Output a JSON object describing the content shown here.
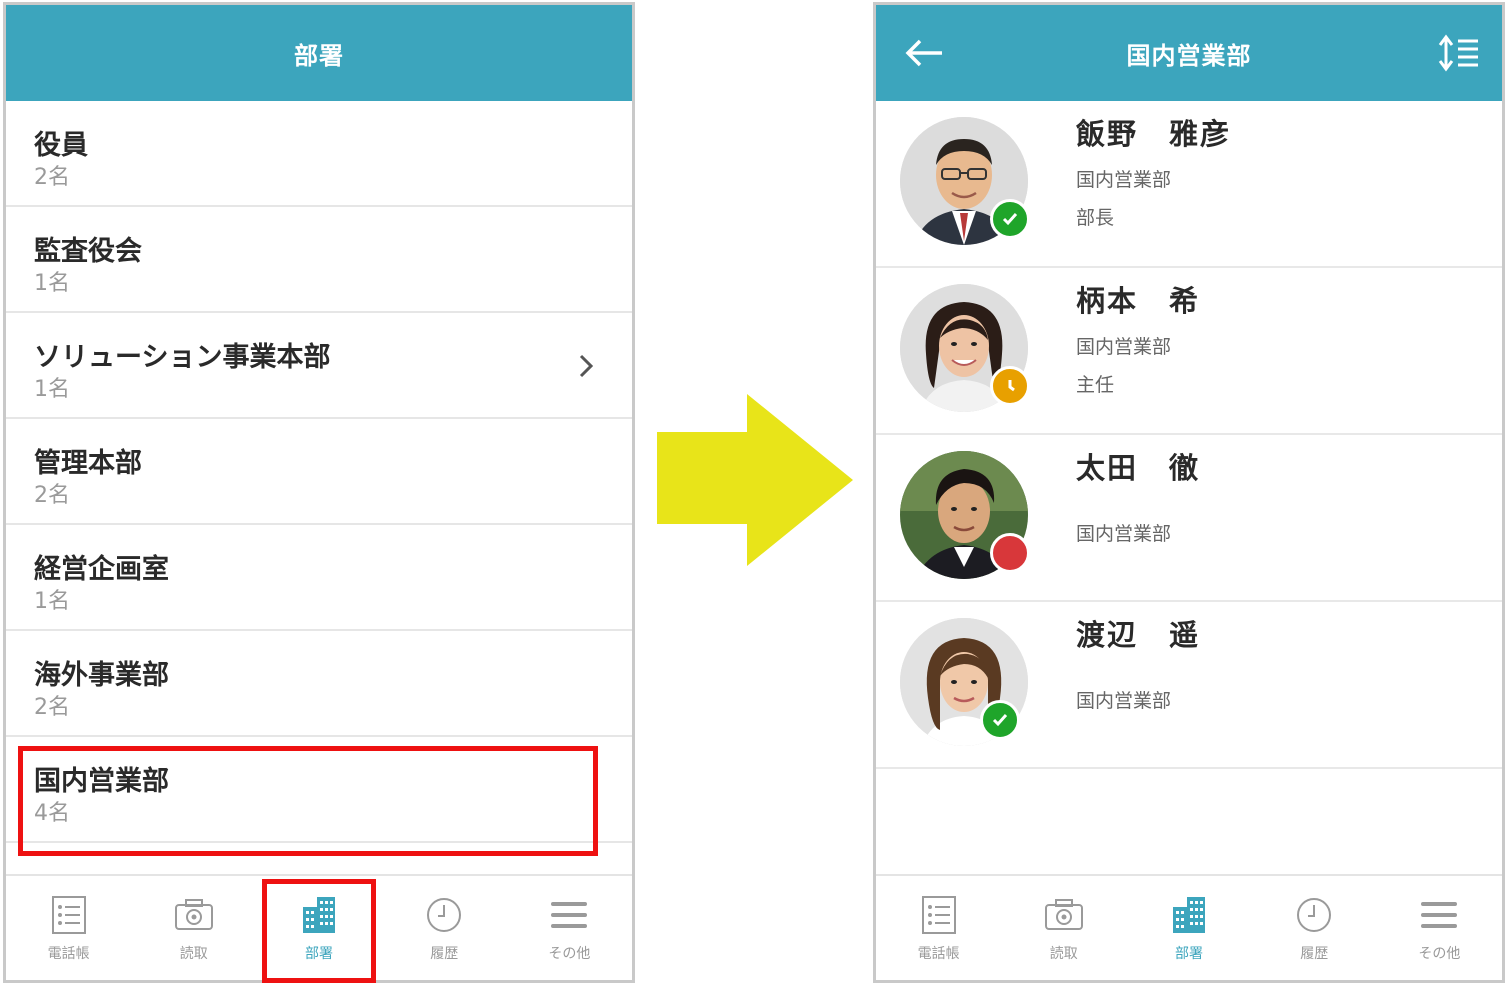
{
  "left": {
    "header_title": "部署",
    "departments": [
      {
        "name": "役員",
        "count": "2名",
        "has_children": false
      },
      {
        "name": "監査役会",
        "count": "1名",
        "has_children": false
      },
      {
        "name": "ソリューション事業本部",
        "count": "1名",
        "has_children": true
      },
      {
        "name": "管理本部",
        "count": "2名",
        "has_children": false
      },
      {
        "name": "経営企画室",
        "count": "1名",
        "has_children": false
      },
      {
        "name": "海外事業部",
        "count": "2名",
        "has_children": false
      },
      {
        "name": "国内営業部",
        "count": "4名",
        "has_children": false
      }
    ],
    "highlighted_department": "国内営業部",
    "highlighted_tab": "部署"
  },
  "right": {
    "header_title": "国内営業部",
    "members": [
      {
        "name": "飯野　雅彦",
        "dept": "国内営業部",
        "title": "部長",
        "status": "available"
      },
      {
        "name": "柄本　希",
        "dept": "国内営業部",
        "title": "主任",
        "status": "away"
      },
      {
        "name": "太田　徹",
        "dept": "国内営業部",
        "title": "",
        "status": "busy"
      },
      {
        "name": "渡辺　遥",
        "dept": "国内営業部",
        "title": "",
        "status": "available"
      }
    ]
  },
  "tabs": [
    {
      "label": "電話帳",
      "icon": "phonebook-icon"
    },
    {
      "label": "読取",
      "icon": "camera-icon"
    },
    {
      "label": "部署",
      "icon": "building-icon",
      "active": true
    },
    {
      "label": "履歴",
      "icon": "clock-icon"
    },
    {
      "label": "その他",
      "icon": "menu-icon"
    }
  ],
  "colors": {
    "accent": "#3ca5bd",
    "highlight": "#ee1111",
    "arrow": "#e8e419",
    "status_available": "#1fa52a",
    "status_away": "#e8a000",
    "status_busy": "#d8373a"
  }
}
